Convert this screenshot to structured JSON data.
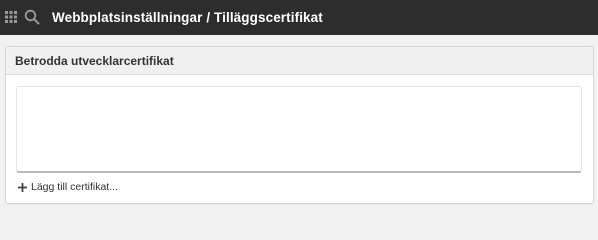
{
  "topbar": {
    "breadcrumb": "Webbplatsinställningar / Tilläggscertifikat",
    "apps_icon": "grid-icon",
    "search_icon": "search-icon"
  },
  "panel": {
    "title": "Betrodda utvecklarcertifikat",
    "certificates": [],
    "add_label": "Lägg till certifikat...",
    "add_icon": "plus-icon"
  },
  "colors": {
    "topbar_bg": "#2d2d2d",
    "page_bg": "#f1f1f1",
    "panel_header_bg": "#f0f0f0"
  }
}
